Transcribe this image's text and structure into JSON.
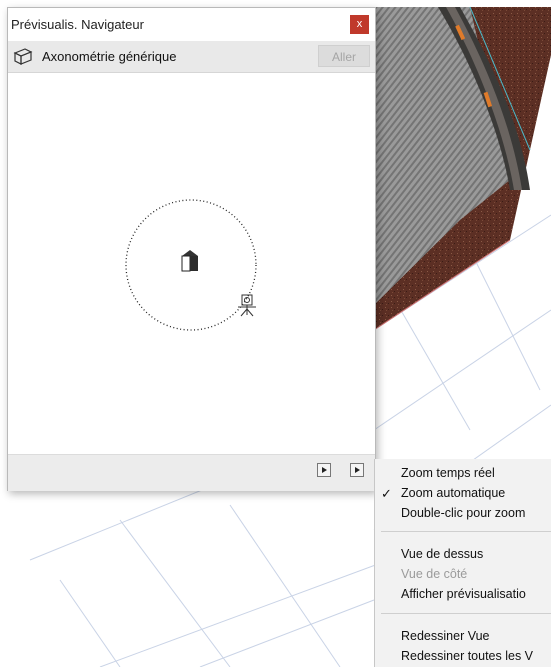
{
  "panel": {
    "title": "Prévisualis. Navigateur",
    "close_label": "x",
    "view_name": "Axonométrie générique",
    "go_label": "Aller"
  },
  "icons": {
    "view": "cube-outline-icon",
    "close": "close-icon",
    "building": "house-block-icon",
    "camera": "camera-on-tripod-icon",
    "footer_left": "play-arrow-icon",
    "footer_right": "menu-arrow-icon"
  },
  "menu": {
    "items": [
      {
        "label": "Zoom temps réel",
        "checked": false,
        "enabled": true
      },
      {
        "label": "Zoom automatique",
        "checked": true,
        "enabled": true
      },
      {
        "label": "Double-clic pour zoom",
        "checked": false,
        "enabled": true
      },
      {
        "label": "Vue de dessus",
        "checked": false,
        "enabled": true
      },
      {
        "label": "Vue de côté",
        "checked": false,
        "enabled": false
      },
      {
        "label": "Afficher prévisualisatio",
        "checked": false,
        "enabled": true
      },
      {
        "label": "Redessiner Vue",
        "checked": false,
        "enabled": true
      },
      {
        "label": "Redessiner toutes les V",
        "checked": false,
        "enabled": true
      }
    ],
    "check_glyph": "✓"
  },
  "colors": {
    "close_button": "#c0392b",
    "grid_line": "#c9d3e6",
    "roof_stripes": "#8b8b8b",
    "terrain": "#5a2e22"
  }
}
